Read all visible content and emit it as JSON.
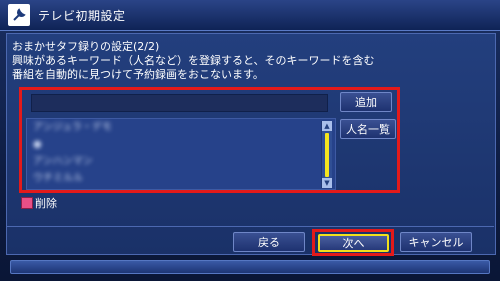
{
  "window": {
    "title": "テレビ初期設定",
    "icon": "wrench-icon"
  },
  "dialog": {
    "heading": "おまかせタフ録りの設定(2/2)",
    "description_line1": "興味があるキーワード（人名など）を登録すると、そのキーワードを含む",
    "description_line2": "番組を自動的に見つけて予約録画をおこないます。"
  },
  "keyword": {
    "input_value": ""
  },
  "buttons": {
    "add": "追加",
    "name_list": "人名一覧",
    "back": "戻る",
    "next": "次へ",
    "cancel": "キャンセル"
  },
  "list": {
    "items": [
      "アンジュラ・デモ",
      "●",
      "アンハンマン",
      "ウチミルル"
    ]
  },
  "delete": {
    "label": "削除",
    "color": "#e84f87"
  },
  "colors": {
    "highlight": "#e31a1a",
    "accent": "#f5e51e"
  }
}
